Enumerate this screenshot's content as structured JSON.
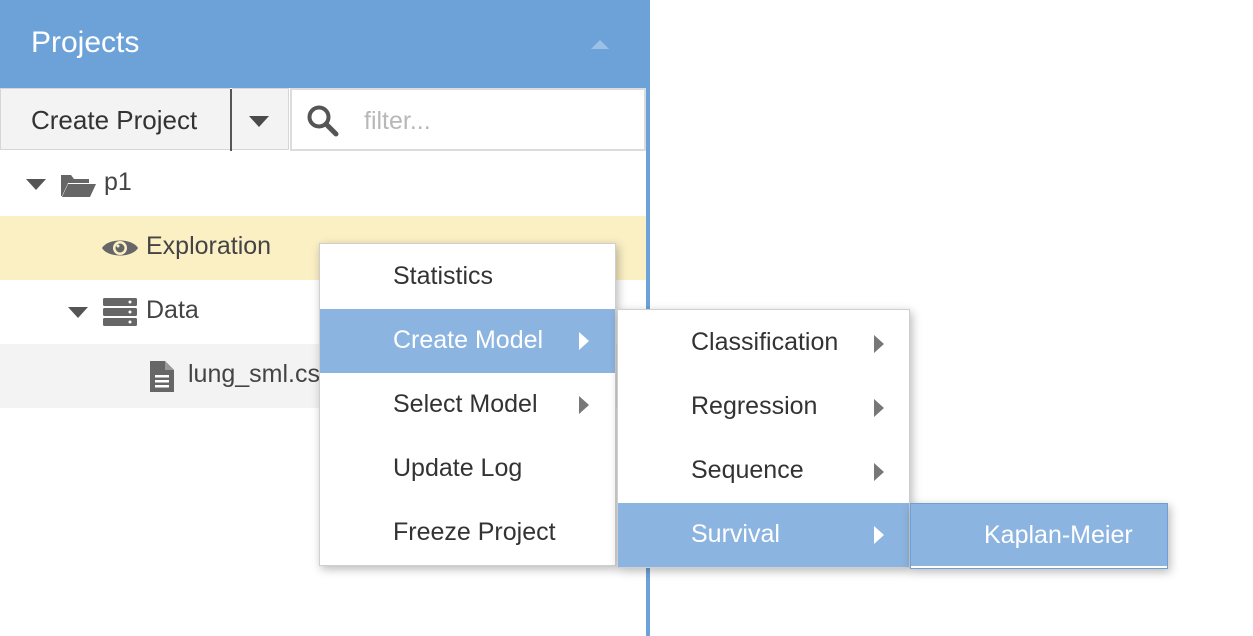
{
  "panel": {
    "title": "Projects",
    "collapse_icon": "caret-up-icon"
  },
  "toolbar": {
    "create_label": "Create Project",
    "dropdown_icon": "caret-down-icon",
    "search_icon": "search-icon",
    "filter_placeholder": "filter...",
    "filter_value": ""
  },
  "tree": {
    "project": {
      "label": "p1",
      "icon": "folder-open-icon",
      "expanded": true
    },
    "exploration": {
      "label": "Exploration",
      "icon": "eye-icon",
      "selected": true
    },
    "data": {
      "label": "Data",
      "icon": "server-icon",
      "expanded": true
    },
    "file": {
      "label": "lung_sml.cs",
      "icon": "file-text-icon"
    }
  },
  "context_menu": {
    "items": [
      {
        "label": "Statistics",
        "has_submenu": false
      },
      {
        "label": "Create Model",
        "has_submenu": true,
        "active": true
      },
      {
        "label": "Select Model",
        "has_submenu": true
      },
      {
        "label": "Update Log",
        "has_submenu": false
      },
      {
        "label": "Freeze Project",
        "has_submenu": false
      }
    ]
  },
  "create_model_menu": {
    "items": [
      {
        "label": "Classification",
        "has_submenu": true
      },
      {
        "label": "Regression",
        "has_submenu": true
      },
      {
        "label": "Sequence",
        "has_submenu": true
      },
      {
        "label": "Survival",
        "has_submenu": true,
        "active": true
      }
    ]
  },
  "survival_menu": {
    "items": [
      {
        "label": "Kaplan-Meier"
      }
    ]
  },
  "colors": {
    "header": "#6ca2d8",
    "selected_row": "#fbefc4",
    "menu_active": "#8cb4e0"
  }
}
